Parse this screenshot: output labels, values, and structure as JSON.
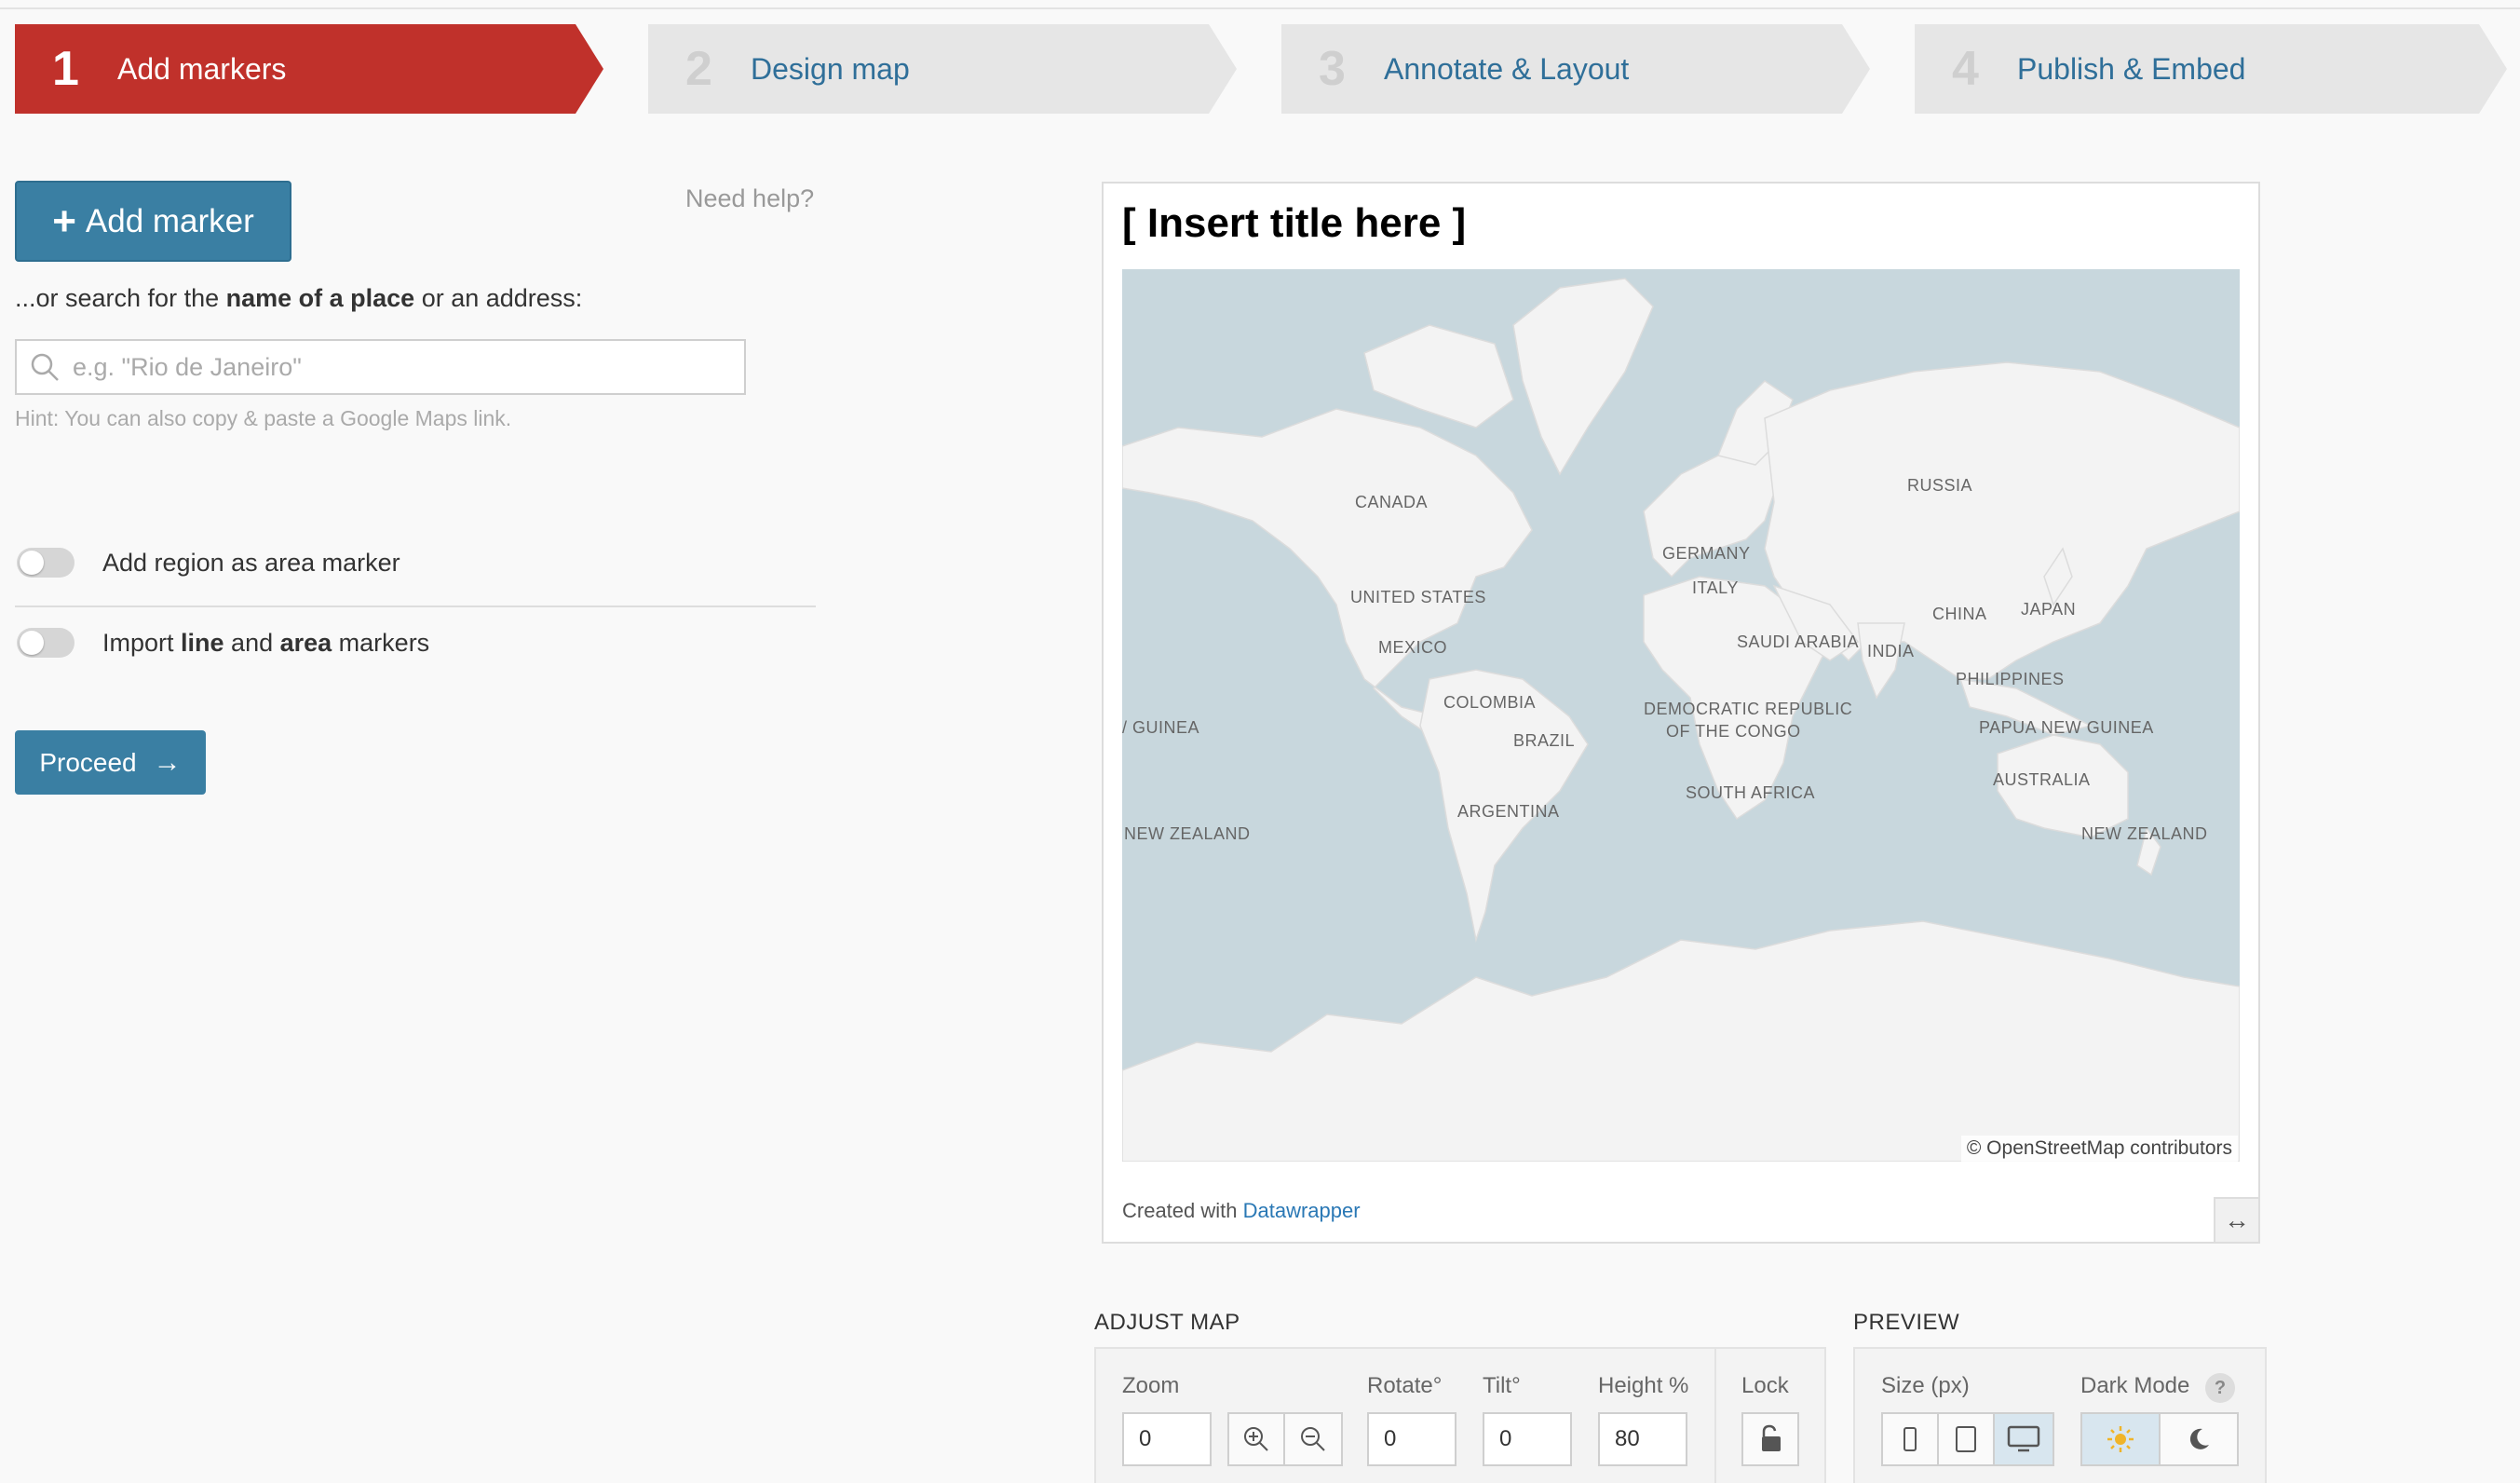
{
  "steps": [
    {
      "num": "1",
      "label": "Add markers"
    },
    {
      "num": "2",
      "label": "Design map"
    },
    {
      "num": "3",
      "label": "Annotate & Layout"
    },
    {
      "num": "4",
      "label": "Publish & Embed"
    }
  ],
  "left": {
    "add_marker_label": "Add marker",
    "need_help": "Need help?",
    "search_prompt_pre": "...or search for the ",
    "search_prompt_bold": "name of a place",
    "search_prompt_post": " or an address:",
    "search_placeholder": "e.g. \"Rio de Janeiro\"",
    "hint": "Hint: You can also copy & paste a Google Maps link.",
    "toggle_region": "Add region as area marker",
    "import_pre": "Import ",
    "import_line": "line",
    "import_and": " and ",
    "import_area": "area",
    "import_post": " markers",
    "proceed_label": "Proceed"
  },
  "card": {
    "title": "[ Insert title here ]",
    "attribution": "© OpenStreetMap contributors",
    "credit_pre": "Created with ",
    "credit_link": "Datawrapper",
    "map_labels": {
      "canada": "CANADA",
      "russia": "RUSSIA",
      "germany": "GERMANY",
      "italy": "ITALY",
      "united_states": "UNITED STATES",
      "china": "CHINA",
      "japan": "JAPAN",
      "saudi_arabia": "SAUDI ARABIA",
      "india": "INDIA",
      "mexico": "MEXICO",
      "philippines": "PHILIPPINES",
      "colombia": "COLOMBIA",
      "drc_1": "DEMOCRATIC REPUBLIC",
      "drc_2": "OF THE CONGO",
      "brazil": "BRAZIL",
      "png_left": "/ GUINEA",
      "png_right": "PAPUA NEW GUINEA",
      "australia": "AUSTRALIA",
      "south_africa": "SOUTH AFRICA",
      "argentina": "ARGENTINA",
      "nz_left": "NEW ZEALAND",
      "nz_right": "NEW ZEALAND"
    }
  },
  "adjust": {
    "heading": "ADJUST MAP",
    "zoom_label": "Zoom",
    "zoom_value": "0",
    "rotate_label": "Rotate°",
    "rotate_value": "0",
    "tilt_label": "Tilt°",
    "tilt_value": "0",
    "height_label": "Height %",
    "height_value": "80",
    "lock_label": "Lock"
  },
  "preview": {
    "heading": "PREVIEW",
    "size_label": "Size (px)",
    "dark_label": "Dark Mode",
    "help": "?"
  },
  "colors": {
    "active_step": "#c0312b",
    "primary_button": "#3a7fa3",
    "ocean": "#c8d7dd",
    "land": "#f2f2f2"
  }
}
